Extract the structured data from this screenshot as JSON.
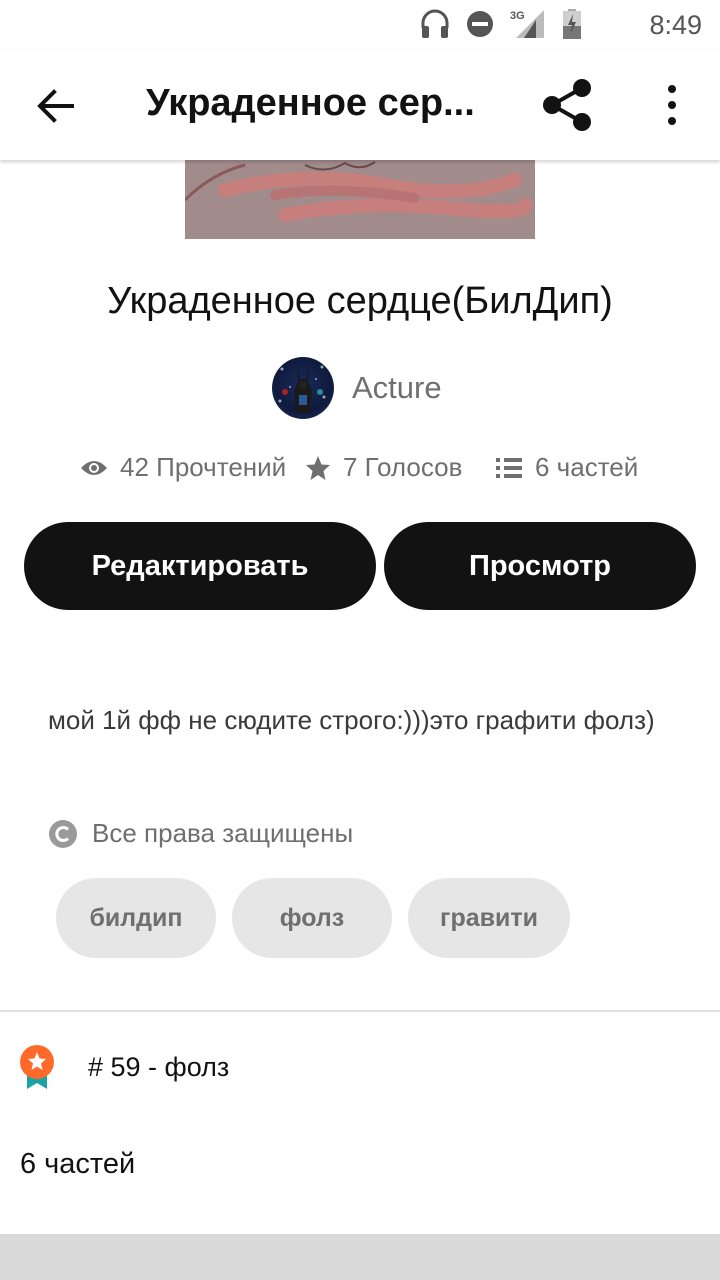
{
  "status_bar": {
    "time": "8:49",
    "network": "3G",
    "icons": [
      "headphones-icon",
      "do-not-disturb-icon",
      "signal-icon",
      "battery-icon"
    ]
  },
  "toolbar": {
    "title": "Украденное сер...",
    "icons": [
      "back-arrow-icon",
      "share-icon",
      "more-vert-icon"
    ]
  },
  "story": {
    "title": "Украденное сердце(БилДип)",
    "author": "Acture"
  },
  "stats": {
    "reads": "42 Прочтений",
    "votes": "7 Голосов",
    "parts": "6 частей"
  },
  "actions": {
    "edit_label": "Редактировать",
    "view_label": "Просмотр"
  },
  "description": "мой 1й фф не сюдите строго:)))это графити фолз)",
  "copyright": "Все права защищены",
  "tags": [
    "билдип",
    "фолз",
    "гравити"
  ],
  "ranking": "# 59 - фолз",
  "parts_heading": "6 частей",
  "colors": {
    "primary_dark": "#121212",
    "secondary_text": "#6f6f6f",
    "tag_bg": "#e6e6e6",
    "badge_orange": "#ff6a2b",
    "badge_teal": "#1aa3a3"
  }
}
